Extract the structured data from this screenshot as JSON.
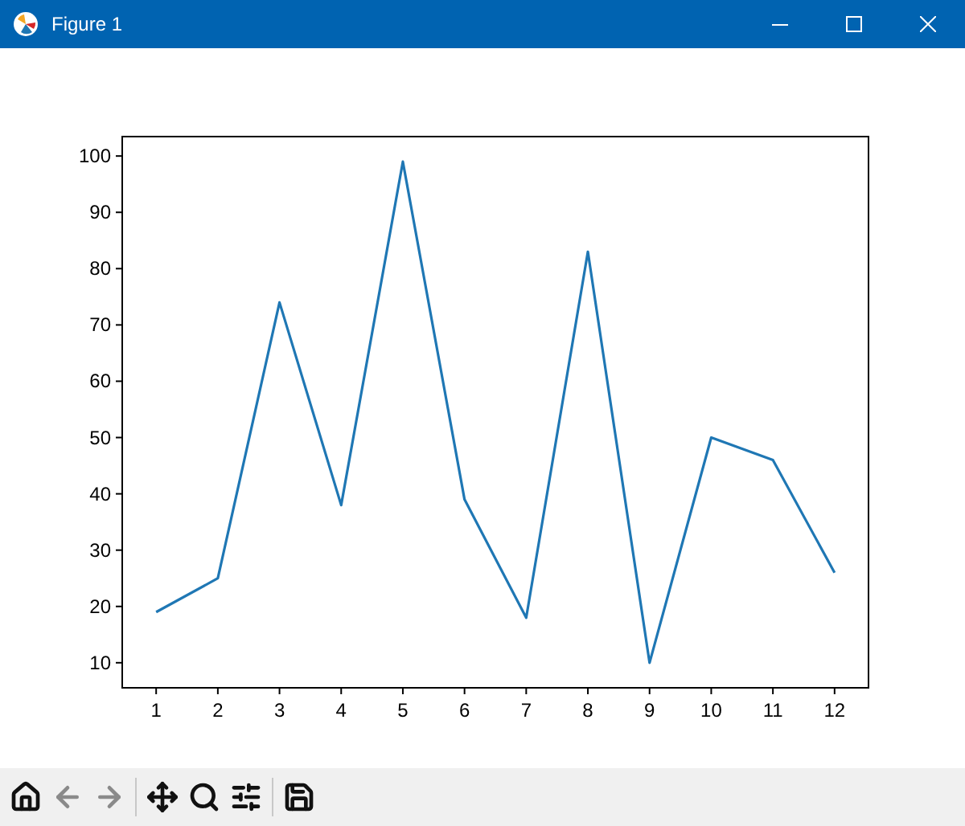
{
  "window": {
    "title": "Figure 1"
  },
  "figure": {
    "chart_data": {
      "type": "line",
      "x": [
        1,
        2,
        3,
        4,
        5,
        6,
        7,
        8,
        9,
        10,
        11,
        12
      ],
      "series": [
        {
          "color": "#1f77b4",
          "values": [
            19,
            25,
            74,
            38,
            99,
            39,
            18,
            83,
            10,
            50,
            46,
            26
          ]
        }
      ],
      "xlim": [
        0.45,
        12.55
      ],
      "ylim": [
        5.55,
        103.45
      ],
      "xticks": [
        1,
        2,
        3,
        4,
        5,
        6,
        7,
        8,
        9,
        10,
        11,
        12
      ],
      "yticks": [
        10,
        20,
        30,
        40,
        50,
        60,
        70,
        80,
        90,
        100
      ]
    }
  },
  "toolbar": [
    {
      "kind": "home",
      "disabled": false
    },
    {
      "kind": "back",
      "disabled": true
    },
    {
      "kind": "forward",
      "disabled": true
    },
    {
      "kind": "separator"
    },
    {
      "kind": "pan",
      "disabled": false
    },
    {
      "kind": "zoom",
      "disabled": false
    },
    {
      "kind": "configure",
      "disabled": false
    },
    {
      "kind": "separator"
    },
    {
      "kind": "save",
      "disabled": false
    }
  ]
}
